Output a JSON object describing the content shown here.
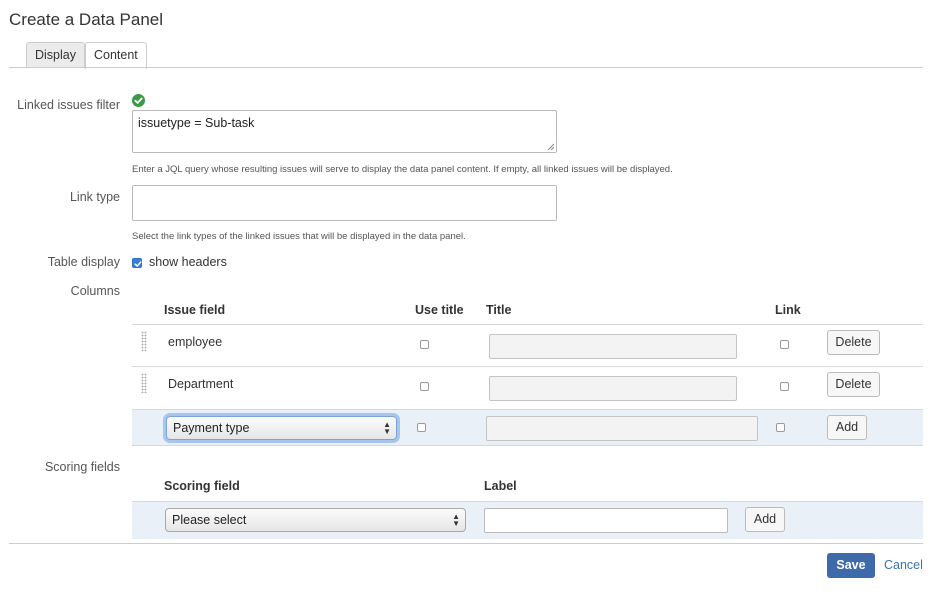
{
  "page": {
    "title": "Create a Data Panel"
  },
  "tabs": [
    {
      "label": "Display",
      "active": false
    },
    {
      "label": "Content",
      "active": true
    }
  ],
  "linked_issues_filter": {
    "label": "Linked issues filter",
    "status_icon": "check-circle-icon",
    "value": "issuetype = Sub-task",
    "help": "Enter a JQL query whose resulting issues will serve to display the data panel content. If empty, all linked issues will be displayed."
  },
  "link_type": {
    "label": "Link type",
    "value": "",
    "help": "Select the link types of the linked issues that will be displayed in the data panel."
  },
  "table_display": {
    "label": "Table display",
    "checkbox_label": "show headers",
    "checked": true
  },
  "columns": {
    "label": "Columns",
    "headers": {
      "issue_field": "Issue field",
      "use_title": "Use title",
      "title": "Title",
      "link": "Link"
    },
    "rows": [
      {
        "field": "employee",
        "use_title": false,
        "title": "",
        "link": false,
        "action": "Delete"
      },
      {
        "field": "Department",
        "use_title": false,
        "title": "",
        "link": false,
        "action": "Delete"
      }
    ],
    "new_row": {
      "field": "Payment type",
      "use_title": false,
      "title": "",
      "link": false,
      "action": "Add"
    }
  },
  "scoring_fields": {
    "label": "Scoring fields",
    "headers": {
      "scoring_field": "Scoring field",
      "label": "Label"
    },
    "new_row": {
      "field": "Please select",
      "label": "",
      "action": "Add"
    }
  },
  "footer": {
    "save": "Save",
    "cancel": "Cancel"
  },
  "colors": {
    "primary": "#3f6aaa",
    "link": "#3b73af",
    "success": "#3b9a45",
    "row_highlight": "#eaf0f8"
  }
}
